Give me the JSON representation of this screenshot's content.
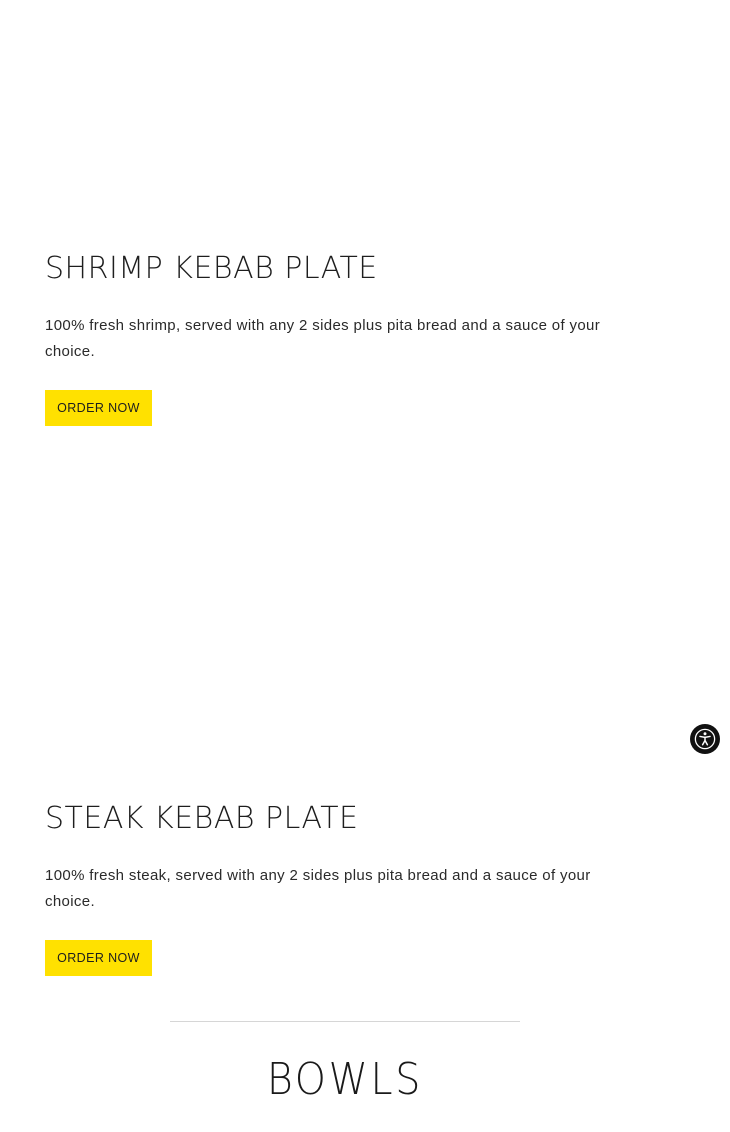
{
  "menu_items": [
    {
      "title": "SHRIMP KEBAB PLATE",
      "description": "100% fresh shrimp, served with any 2 sides plus pita bread and a sauce of your choice.",
      "button_label": "ORDER NOW"
    },
    {
      "title": "STEAK KEBAB PLATE",
      "description": "100% fresh steak, served with any 2 sides plus pita bread and a sauce of your choice.",
      "button_label": "ORDER NOW"
    }
  ],
  "section": {
    "title": "BOWLS"
  },
  "accessibility": {
    "icon": "accessibility-icon",
    "aria_label": "Accessibility options"
  },
  "colors": {
    "button_background": "#ffe100",
    "text": "#1e1e1e",
    "accessibility_button": "#111111",
    "divider": "#d6d6d6"
  }
}
